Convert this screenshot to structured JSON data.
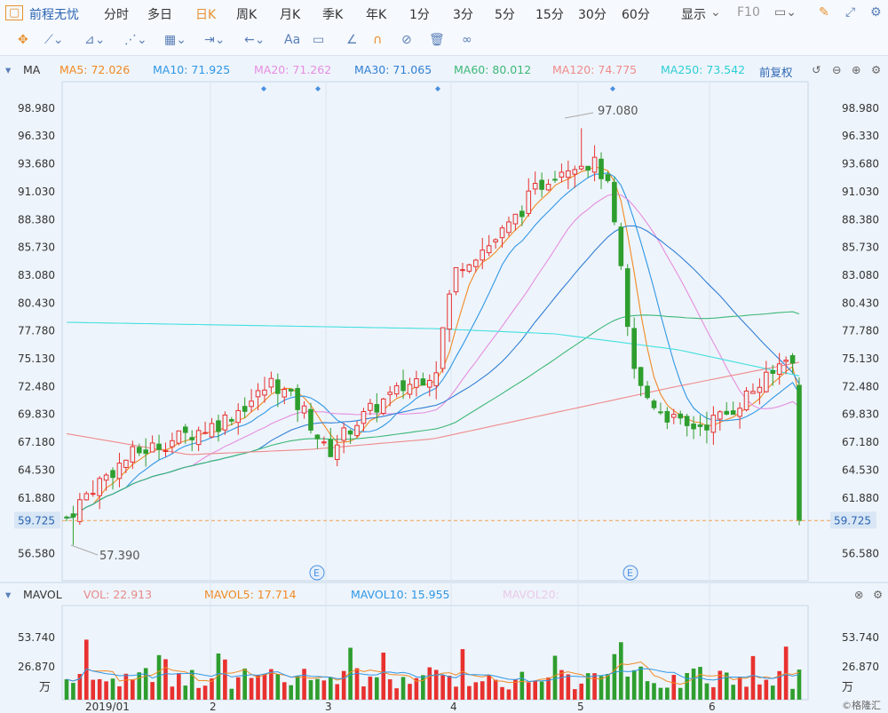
{
  "toolbar": {
    "stock_name": "前程无忧",
    "periods": [
      "分时",
      "多日",
      "日K",
      "周K",
      "月K",
      "季K",
      "年K",
      "1分",
      "3分",
      "5分",
      "15分",
      "30分",
      "60分"
    ],
    "active_period": "日K",
    "display_label": "显示",
    "f10_label": "F10"
  },
  "indicators": {
    "ma_label": "MA",
    "ma5": "MA5: 72.026",
    "ma10": "MA10: 71.925",
    "ma20": "MA20: 71.262",
    "ma30": "MA30: 71.065",
    "ma60": "MA60: 80.012",
    "ma120": "MA120: 74.775",
    "ma250": "MA250: 73.542",
    "adjust_label": "前复权",
    "vol_label": "MAVOL",
    "vol": "VOL: 22.913",
    "mavol5": "MAVOL5: 17.714",
    "mavol10": "MAVOL10: 15.955",
    "mavol20": "MAVOL20:"
  },
  "colors": {
    "up": "#e8312f",
    "down": "#2e9e2e",
    "ma5": "#f08a24",
    "ma10": "#2e97e6",
    "ma20": "#e58ee0",
    "ma30": "#2f7fd6",
    "ma60": "#3cb878",
    "ma120": "#ef8b8b",
    "ma250": "#43e0e0"
  },
  "chart_data": {
    "type": "candlestick",
    "y_ticks": [
      "98.980",
      "96.330",
      "93.680",
      "91.030",
      "88.380",
      "85.730",
      "83.080",
      "80.430",
      "77.780",
      "75.130",
      "72.480",
      "69.830",
      "67.180",
      "64.530",
      "61.880",
      "56.580"
    ],
    "current_price": "59.725",
    "high_label": "97.080",
    "low_label": "57.390",
    "x_labels": [
      "2019/01",
      "2",
      "3",
      "4",
      "5",
      "6"
    ],
    "vol_ticks": [
      "53.740",
      "26.870"
    ],
    "vol_unit": "万",
    "event_marks": [
      "E",
      "E"
    ],
    "watermark": "©格隆汇",
    "price_range": [
      54.0,
      101.0
    ],
    "vol_range": [
      0,
      68
    ],
    "candles_count": 112
  }
}
